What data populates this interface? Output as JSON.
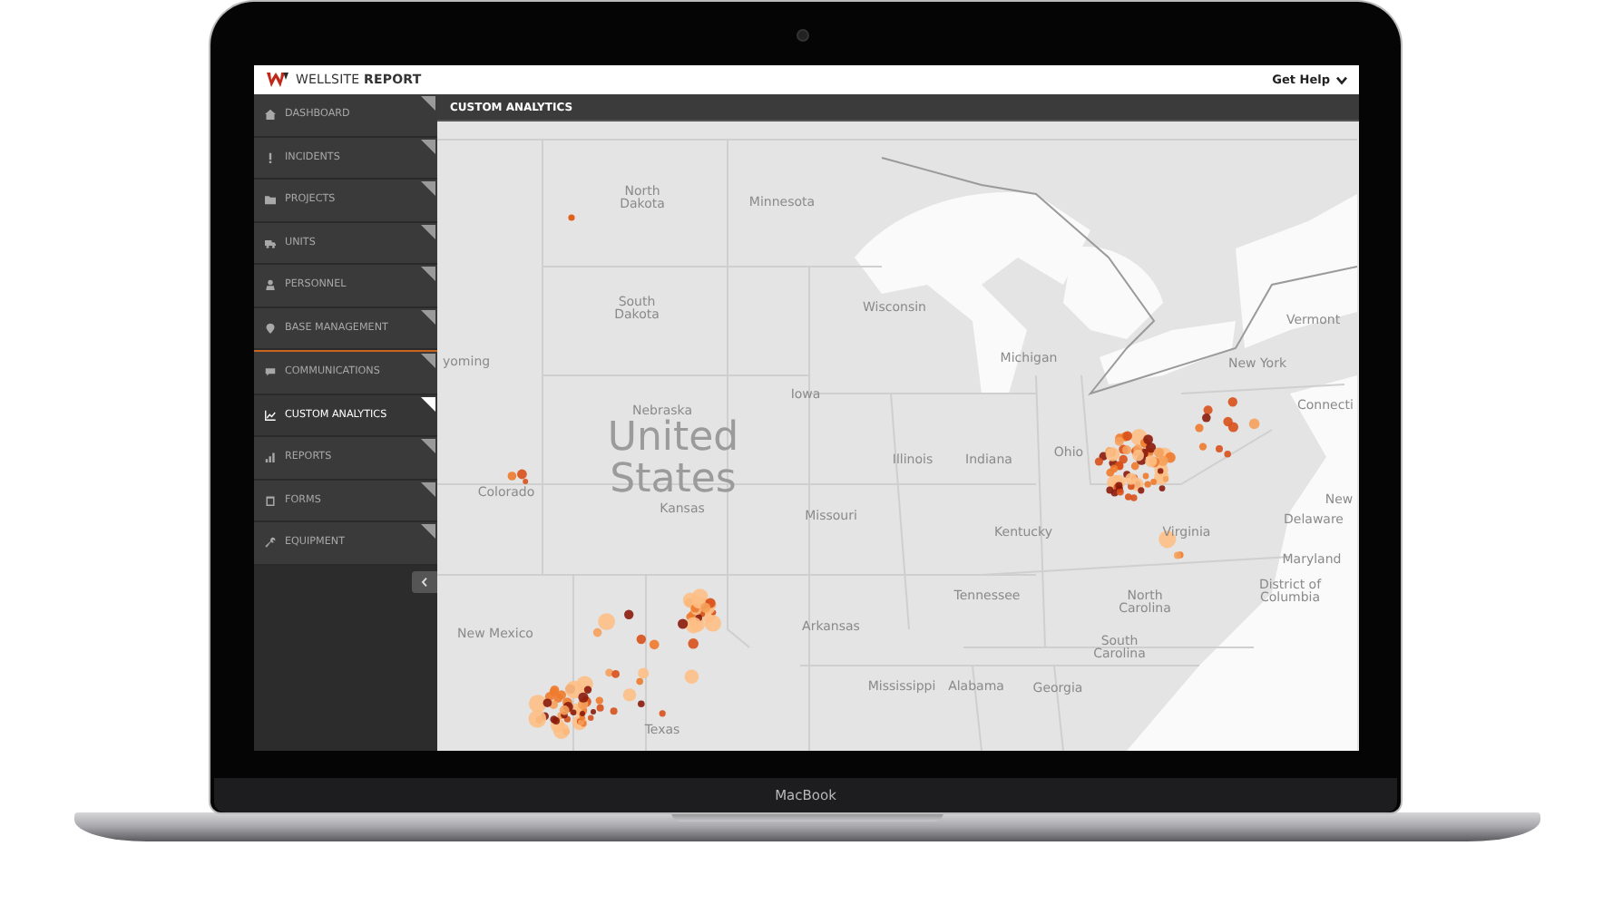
{
  "header": {
    "logo_text": "WELLSITE **REPORT**",
    "help_menu": "Get Help"
  },
  "sidebar": {
    "groups": [
      [
        {
          "label": "DASHBOARD",
          "selected": false
        },
        {
          "label": "INCIDENTS",
          "selected": false
        },
        {
          "label": "PROJECTS",
          "selected": false
        },
        {
          "label": "UNITS",
          "selected": false
        },
        {
          "label": "PERSONNEL",
          "selected": false
        },
        {
          "label": "BASE MANAGEMENT",
          "selected": false
        }
      ],
      [
        {
          "label": "COMMUNICATIONS",
          "selected": false
        },
        {
          "label": "CUSTOM ANALYTICS",
          "selected": true
        },
        {
          "label": "REPORTS",
          "selected": false
        },
        {
          "label": "FORMS",
          "selected": false
        },
        {
          "label": "EQUIPMENT",
          "selected": false
        }
      ]
    ]
  },
  "panel_title": "CUSTOM ANALYTICS",
  "map": {
    "labels": [
      "North Dakota",
      "Minnesota",
      "South Dakota",
      "Wisconsin",
      "Michigan",
      "New York",
      "Vermont",
      "yoming",
      "Nebraska",
      "Iowa",
      "United States",
      "Connecti",
      "Illinois",
      "Indiana",
      "Ohio",
      "Colorado",
      "Kansas",
      "Missouri",
      "New",
      "Delaware",
      "Kentucky",
      "Virginia",
      "Maryland",
      "Tennessee",
      "North Carolina",
      "District of Columbia",
      "Arkansas",
      "New Mexico",
      "South Carolina",
      "Mississippi",
      "Alabama",
      "Georgia",
      "Texas"
    ]
  },
  "device": {
    "brand": "MacBook"
  }
}
